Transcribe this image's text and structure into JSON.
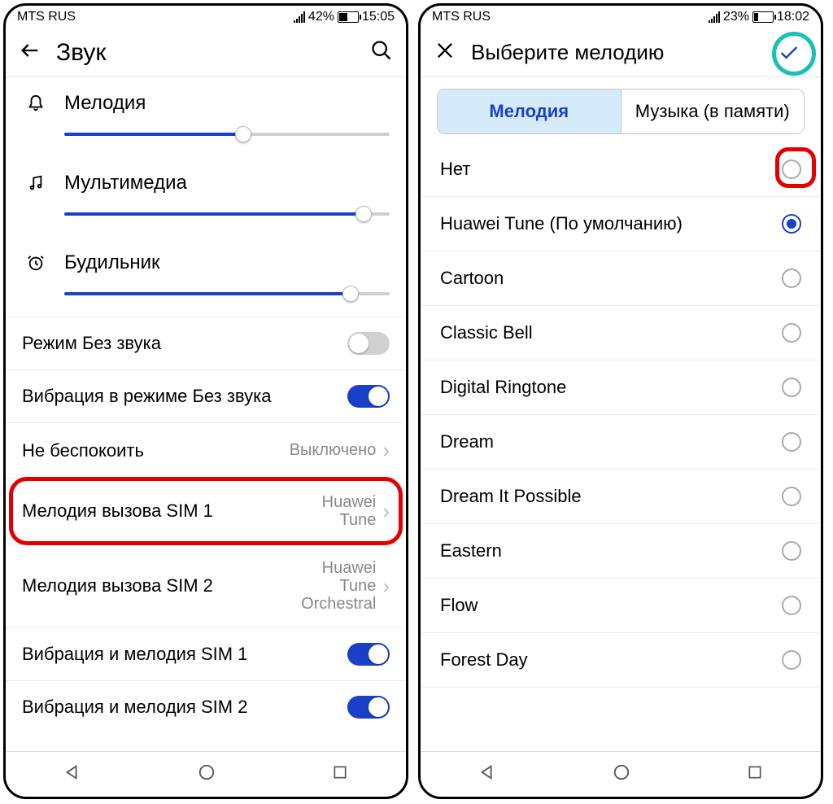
{
  "left": {
    "status": {
      "carrier": "MTS RUS",
      "battery_pct": "42%",
      "time": "15:05",
      "battery_fill_pct": 42
    },
    "header": {
      "title": "Звук"
    },
    "volumes": [
      {
        "label": "Мелодия",
        "value_pct": 55,
        "icon": "bell"
      },
      {
        "label": "Мультимедиа",
        "value_pct": 92,
        "icon": "music"
      },
      {
        "label": "Будильник",
        "value_pct": 88,
        "icon": "alarm"
      }
    ],
    "rows": [
      {
        "label": "Режим Без звука",
        "type": "toggle",
        "on": false
      },
      {
        "label": "Вибрация в режиме Без звука",
        "type": "toggle",
        "on": true
      },
      {
        "label": "Не беспокоить",
        "type": "value",
        "value": "Выключено"
      },
      {
        "label": "Мелодия вызова SIM 1",
        "type": "value2",
        "value": "Huawei\nTune",
        "highlight": true
      },
      {
        "label": "Мелодия вызова SIM 2",
        "type": "value2",
        "value": "Huawei\nTune\nOrchestral"
      },
      {
        "label": "Вибрация и мелодия SIM 1",
        "type": "toggle",
        "on": true
      },
      {
        "label": "Вибрация и мелодия SIM 2",
        "type": "toggle",
        "on": true
      }
    ]
  },
  "right": {
    "status": {
      "carrier": "MTS RUS",
      "battery_pct": "23%",
      "time": "18:02",
      "battery_fill_pct": 23
    },
    "header": {
      "title": "Выберите мелодию"
    },
    "tabs": {
      "a": "Мелодия",
      "b": "Музыка (в памяти)"
    },
    "ringtones": [
      {
        "name": "Нет",
        "selected": false,
        "highlight": true
      },
      {
        "name": "Huawei Tune (По умолчанию)",
        "selected": true
      },
      {
        "name": "Cartoon",
        "selected": false
      },
      {
        "name": "Classic Bell",
        "selected": false
      },
      {
        "name": "Digital Ringtone",
        "selected": false
      },
      {
        "name": "Dream",
        "selected": false
      },
      {
        "name": "Dream It Possible",
        "selected": false
      },
      {
        "name": "Eastern",
        "selected": false
      },
      {
        "name": "Flow",
        "selected": false
      },
      {
        "name": "Forest Day",
        "selected": false
      }
    ]
  }
}
